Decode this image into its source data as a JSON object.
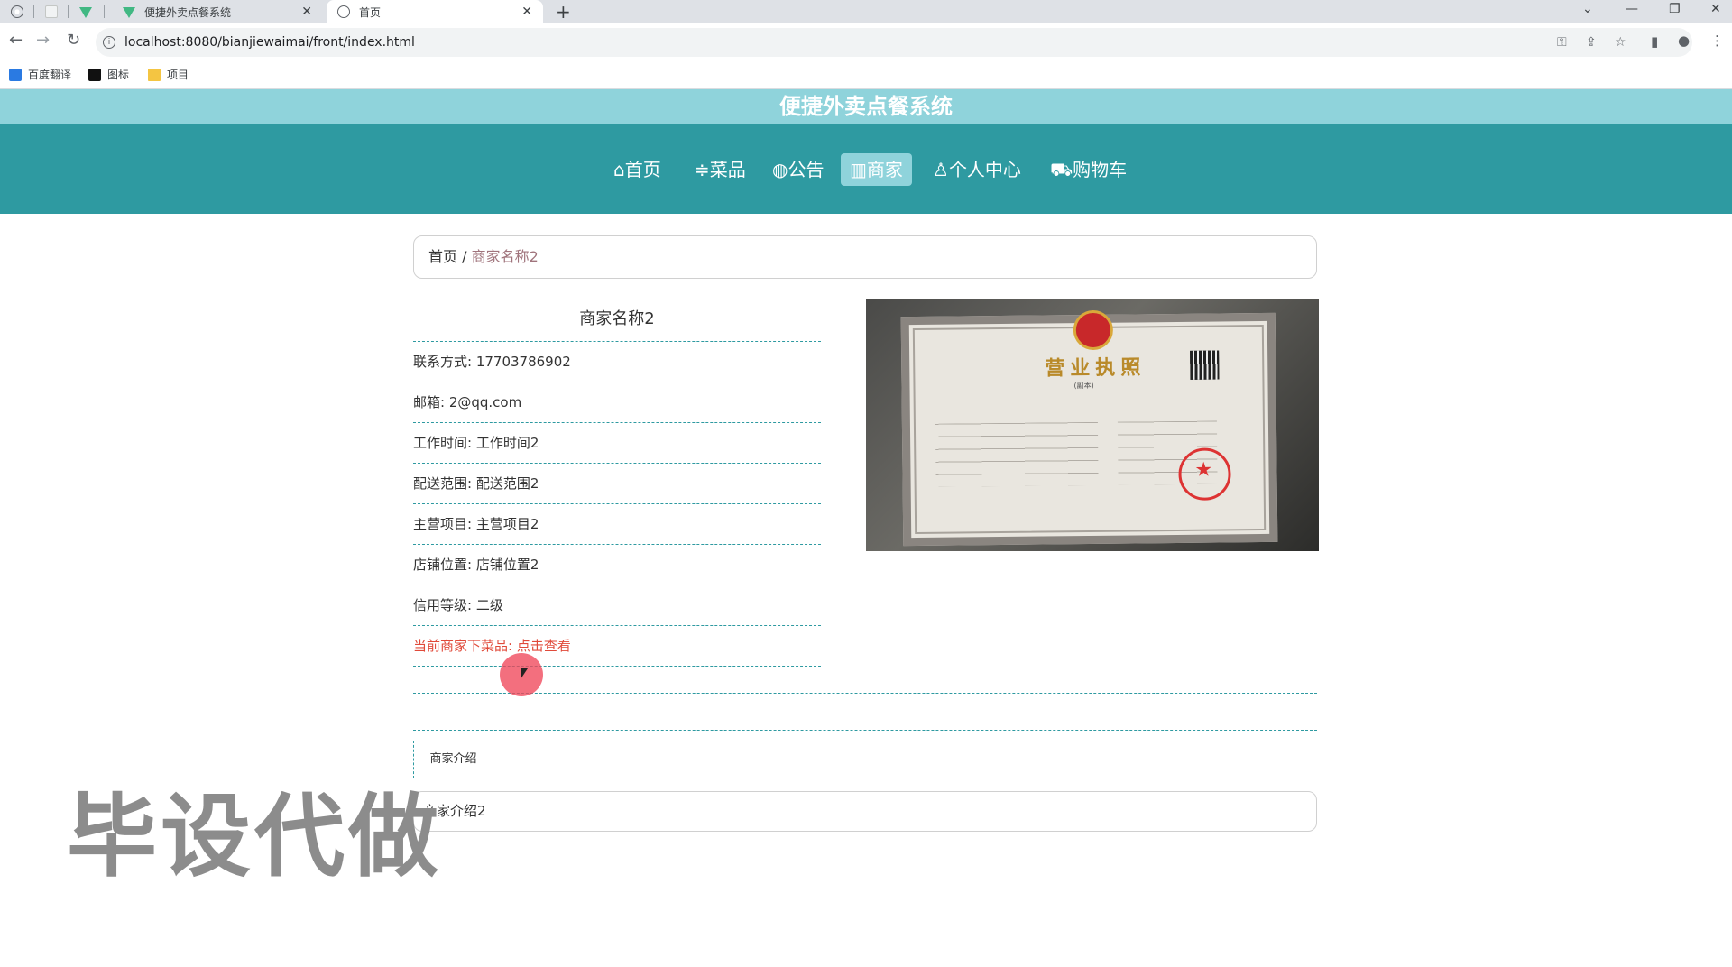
{
  "browser": {
    "tabs": [
      {
        "title": "",
        "icon": "globe-icon"
      },
      {
        "title": "",
        "icon": "blank-page-icon"
      },
      {
        "title": "",
        "icon": "vue-icon"
      },
      {
        "title": "便捷外卖点餐系统",
        "icon": "vue-icon"
      },
      {
        "title": "首页",
        "icon": "globe-icon"
      }
    ],
    "url": "localhost:8080/bianjiewaimai/front/index.html",
    "bookmarks": [
      "百度翻译",
      "图标",
      "项目"
    ]
  },
  "page": {
    "site_title": "便捷外卖点餐系统",
    "nav": [
      {
        "icon": "⌂",
        "label": "首页"
      },
      {
        "icon": "≑",
        "label": "菜品"
      },
      {
        "icon": "◍",
        "label": "公告"
      },
      {
        "icon": "▥",
        "label": "商家",
        "active": true
      },
      {
        "icon": "♙",
        "label": "个人中心"
      },
      {
        "icon": "⛟",
        "label": "购物车"
      }
    ],
    "breadcrumb": {
      "home": "首页",
      "sep": " / ",
      "current": "商家名称2"
    },
    "merchant": {
      "name": "商家名称2",
      "fields": [
        "联系方式: 17703786902",
        "邮箱: 2@qq.com",
        "工作时间: 工作时间2",
        "配送范围: 配送范围2",
        "主营项目: 主营项目2",
        "店铺位置: 店铺位置2",
        "信用等级: 二级"
      ],
      "dishes_link": "当前商家下菜品: 点击查看"
    },
    "license_image": {
      "title": "营业执照",
      "subtitle": "(副本)"
    },
    "intro_tab": "商家介绍",
    "intro_text": "商家介绍2",
    "watermark": "毕设代做"
  }
}
